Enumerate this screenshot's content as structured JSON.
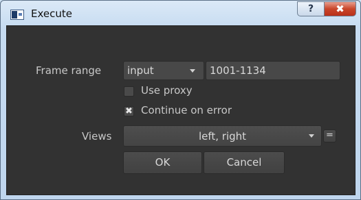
{
  "window": {
    "title": "Execute"
  },
  "caption": {
    "help": "?",
    "close": "✖"
  },
  "frame_range": {
    "label": "Frame range",
    "mode": "input",
    "value": "1001-1134"
  },
  "use_proxy": {
    "label": "Use proxy",
    "checked": false
  },
  "continue_on_error": {
    "label": "Continue on error",
    "checked": true,
    "mark": "✖"
  },
  "views": {
    "label": "Views",
    "value": "left, right",
    "link_label": "="
  },
  "buttons": {
    "ok": "OK",
    "cancel": "Cancel"
  }
}
